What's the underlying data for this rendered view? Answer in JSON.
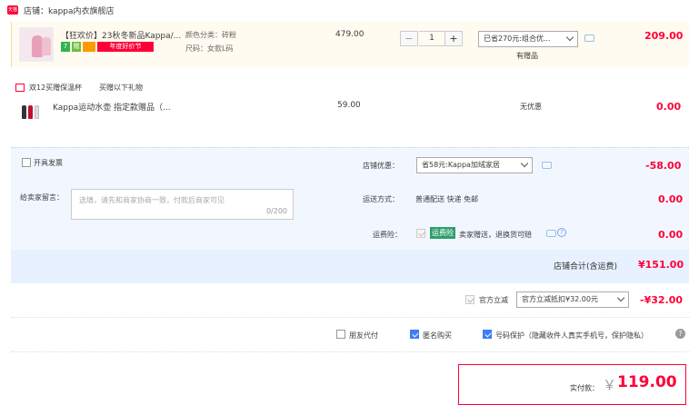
{
  "shop": {
    "label": "店铺：kappa内衣旗舰店",
    "icon_text": "天猫"
  },
  "item": {
    "title": "【狂欢价】23秋冬新品Kappa/...",
    "badges": [
      "7",
      "赠",
      "",
      "年度好价节"
    ],
    "color": "颜色分类：砖粉",
    "size": "尺码：女款L码",
    "price": "479.00",
    "quantity": "1",
    "minus": "−",
    "plus": "+",
    "promo_select": "已省270元:组合优...",
    "gift_note": "有赠品",
    "subtotal": "209.00"
  },
  "gift": {
    "header_1": "双12买赠保温杯",
    "header_2": "买赠以下礼物",
    "title": "Kappa运动水壶 指定款赠品（...",
    "price": "59.00",
    "discount": "无优惠",
    "subtotal": "0.00"
  },
  "form": {
    "invoice_label": "开具发票",
    "message_label": "给卖家留言：",
    "message_placeholder": "选填，请先和商家协商一致，付款后商家可见",
    "message_count": "0/200",
    "shop_discount_label": "店铺优惠：",
    "shop_discount_select": "省58元:Kappa加绒家居",
    "shop_discount_value": "-58.00",
    "shipping_label": "运送方式：",
    "shipping_value": "普通配送 快递 免邮",
    "shipping_price": "0.00",
    "insurance_label": "运费险：",
    "insurance_badge": "运费险",
    "insurance_text": "卖家赠送，退换货可赔",
    "insurance_price": "0.00"
  },
  "totals": {
    "shop_total_label": "店铺合计(含运费)",
    "shop_total_value": "¥151.00",
    "official_label": "官方立减",
    "official_select": "官方立减抵扣¥32.00元",
    "official_value": "-¥32.00",
    "friend_pay": "朋友代付",
    "anonymous": "匿名购买",
    "number_protect": "号码保护（隐藏收件人真实手机号，保护隐私）",
    "pay_label": "实付款：",
    "pay_currency": "￥",
    "pay_value": "119.00"
  },
  "colors": {
    "accent": "#ff0036",
    "check": "#3d7ef6",
    "panel": "#f2f7ff"
  }
}
